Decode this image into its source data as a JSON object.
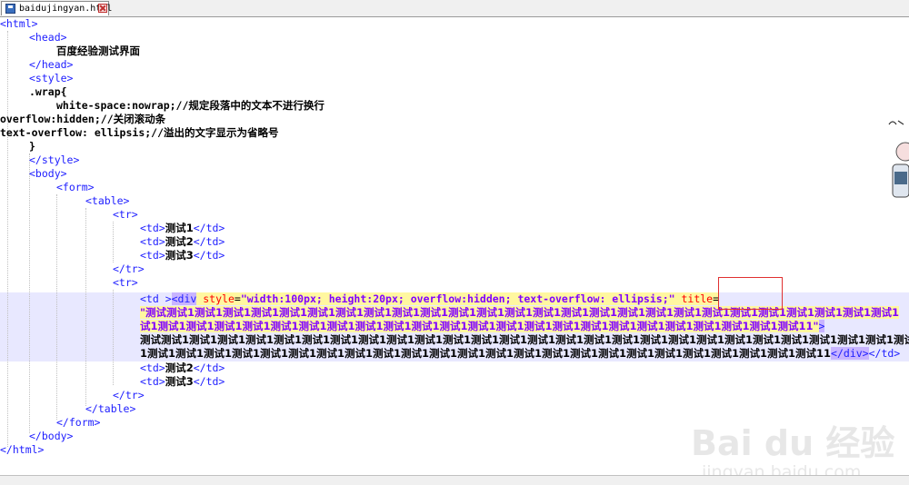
{
  "tab": {
    "filename": "baidujingyan.html",
    "icon": "save-icon",
    "close_icon": "close-icon"
  },
  "code": {
    "l1": "<html>",
    "l2": "<head>",
    "l3": "百度经验测试界面",
    "l4": "</head>",
    "l5": "<style>",
    "l6": ".wrap{",
    "l7": "white-space:nowrap;//规定段落中的文本不进行换行",
    "l8": "overflow:hidden;//关闭滚动条",
    "l9": "text-overflow: ellipsis;//溢出的文字显示为省略号",
    "l10": "}",
    "l11": "</style>",
    "l12": "<body>",
    "l13": "<form>",
    "l14": "<table>",
    "l15": "<tr>",
    "l16_open": "<td>",
    "l16_text": "测试1",
    "l16_close": "</td>",
    "l17_open": "<td>",
    "l17_text": "测试2",
    "l17_close": "</td>",
    "l18_open": "<td>",
    "l18_text": "测试3",
    "l18_close": "</td>",
    "l19": "</tr>",
    "l20": "<tr>",
    "l21_td": "<td >",
    "l21_div": "<div",
    "l21_style_attr": " style",
    "l21_eq": "=",
    "l21_style_val": "\"width:100px; height:20px; overflow:hidden; text-overflow: ellipsis;\"",
    "l21_title_attr": " title",
    "l21_eq2": "=",
    "l22": "\"测试测试1测试1测试1测试1测试1测试1测试1测试1测试1测试1测试1测试1测试1测试1测试1测试1测试1测试1测试1测试1测试1测试1测试1测试1测试1测试1",
    "l23_val": "试1测试1测试1测试1测试1测试1测试1测试1测试1测试1测试1测试1测试1测试1测试1测试1测试1测试1测试1测试1测试1测试1测试1测试11\"",
    "l23_close": ">",
    "l24": "测试测试1测试1测试1测试1测试1测试1测试1测试1测试1测试1测试1测试1测试1测试1测试1测试1测试1测试1测试1测试1测试1测试1测试1测试1测试1测试1测试1",
    "l25_text": "1测试1测试1测试1测试1测试1测试1测试1测试1测试1测试1测试1测试1测试1测试1测试1测试1测试1测试1测试1测试1测试1测试1测试1测试11",
    "l25_divclose": "</div>",
    "l25_tdclose": "</td>",
    "l26_open": "<td>",
    "l26_text": "测试2",
    "l26_close": "</td>",
    "l27_open": "<td>",
    "l27_text": "测试3",
    "l27_close": "</td>",
    "l28": "</tr>",
    "l29": "</table>",
    "l30": "</form>",
    "l31": "</body>",
    "l32": "</html>"
  },
  "watermark": {
    "main": "Bai du 经验",
    "sub": "jingyan.baidu.com"
  },
  "colors": {
    "tag": "#2020ff",
    "attr": "#ff0000",
    "value": "#8000ff",
    "highlight_line": "#e8e8ff",
    "selection": "#c8b4ff"
  }
}
